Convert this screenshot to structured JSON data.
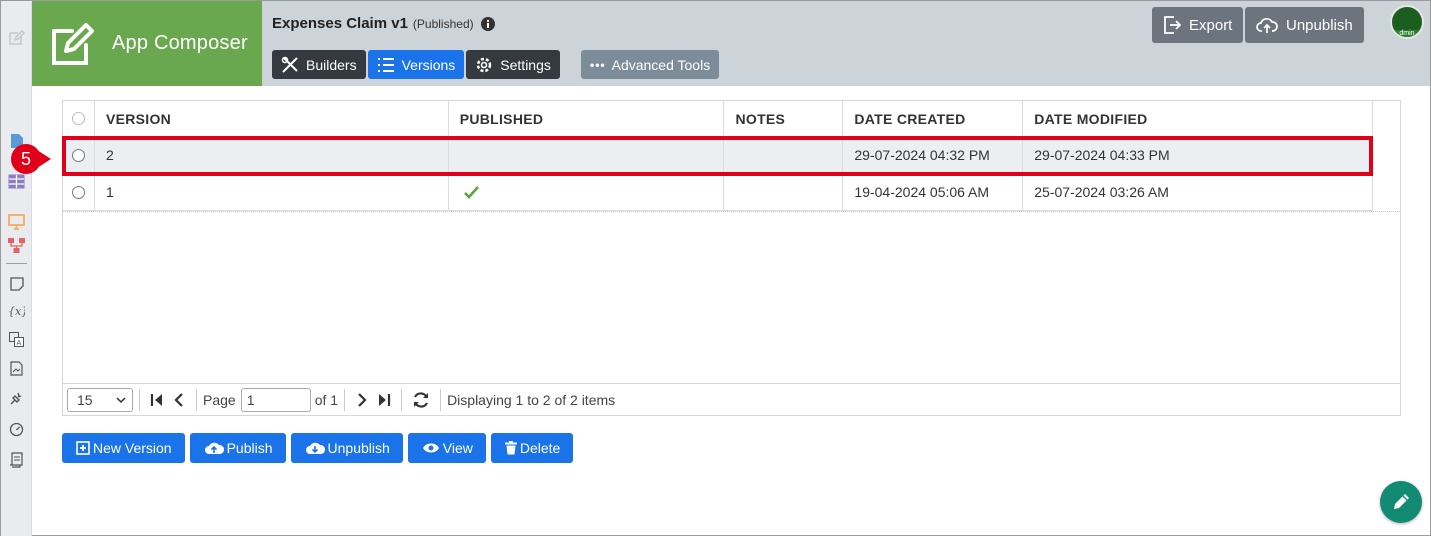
{
  "brand": {
    "title": "App Composer"
  },
  "app": {
    "name": "Expenses Claim v1",
    "status": "(Published)"
  },
  "tabs": [
    {
      "label": "Builders",
      "icon": "tools-icon"
    },
    {
      "label": "Versions",
      "icon": "list-icon",
      "active": true
    },
    {
      "label": "Settings",
      "icon": "gear-icon"
    }
  ],
  "advanced": {
    "label": "Advanced Tools"
  },
  "header_buttons": {
    "export": "Export",
    "unpublish": "Unpublish"
  },
  "avatar": {
    "text": "dmin"
  },
  "grid": {
    "columns": [
      "VERSION",
      "PUBLISHED",
      "NOTES",
      "DATE CREATED",
      "DATE MODIFIED"
    ],
    "rows": [
      {
        "version": "2",
        "published": false,
        "notes": "",
        "date_created": "29-07-2024 04:32 PM",
        "date_modified": "29-07-2024 04:33 PM",
        "selected": true
      },
      {
        "version": "1",
        "published": true,
        "notes": "",
        "date_created": "19-04-2024 05:06 AM",
        "date_modified": "25-07-2024 03:26 AM",
        "selected": false
      }
    ]
  },
  "step_badge": "5",
  "pager": {
    "page_size": "15",
    "page_label": "Page",
    "page_value": "1",
    "of_label": "of 1",
    "status": "Displaying 1 to 2 of 2 items"
  },
  "actions": {
    "new_version": "New Version",
    "publish": "Publish",
    "unpublish": "Unpublish",
    "view": "View",
    "delete": "Delete"
  },
  "colors": {
    "brand_green": "#6aa84f",
    "primary_blue": "#1a73e8",
    "header_gray": "#ccd3d9",
    "highlight_red": "#e0001a",
    "fab_teal": "#138a72"
  }
}
